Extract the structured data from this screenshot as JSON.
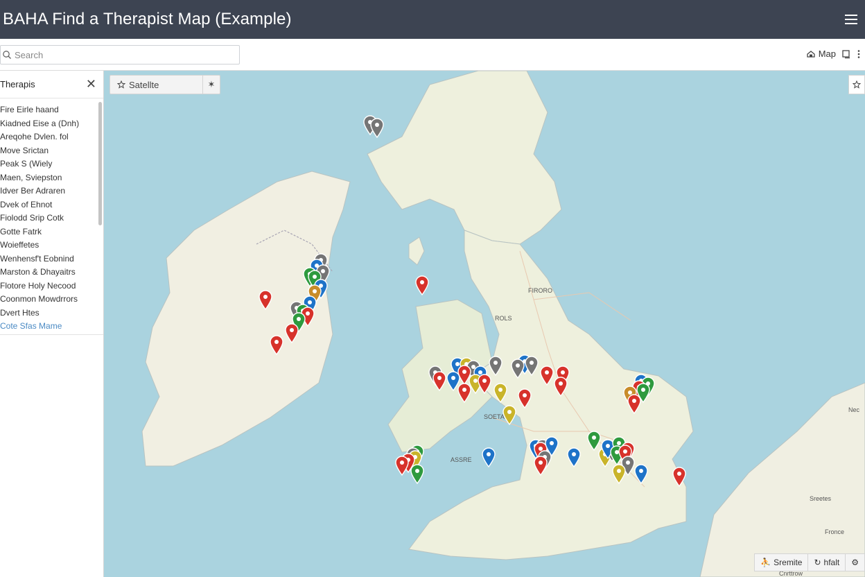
{
  "header": {
    "title": "BAHA Find a Therapist Map (Example)",
    "menu_icon": "hamburger-icon"
  },
  "toolbar": {
    "search_placeholder": "Search",
    "map_label": "Map",
    "icons": [
      "search-icon",
      "map-layers-icon",
      "window-icon",
      "more-vertical-icon"
    ]
  },
  "sidebar": {
    "title": "Therapis",
    "items": [
      "Fire Eirle haand",
      "Kiadned Eise a (Dnh)",
      "Areqohe Dvlen. fol",
      "Move Srictan",
      "Peak S (Wiely",
      "Maen, Sviepston",
      "Idver Ber Adraren",
      "Dvek of Ehnot",
      "Fiolodd Srip Cotk",
      "Gotte Fatrk",
      "Woieffetes",
      "Wenhensf't Eobnind",
      "Marston & Dhayaitrs",
      "Flotore Holy Necood",
      "Coonmon Mowdrrors",
      "Dvert Htes",
      "Cote Sfas Mame"
    ]
  },
  "map": {
    "type_label": "Satellte",
    "bottom_controls": [
      "Sremite",
      "hfalt"
    ],
    "place_labels": [
      "FIRORO",
      "ROLS",
      "SOETA",
      "ASSRE",
      "Nec",
      "Sreetes",
      "Fronce",
      "Cnrttrow"
    ],
    "markers": [
      {
        "lng": -5.45,
        "lat": 57.65,
        "color": "#757575"
      },
      {
        "lng": -5.3,
        "lat": 57.6,
        "color": "#757575"
      },
      {
        "lng": -6.55,
        "lat": 55.2,
        "color": "#757575"
      },
      {
        "lng": -6.65,
        "lat": 55.1,
        "color": "#1e73c8"
      },
      {
        "lng": -6.8,
        "lat": 54.95,
        "color": "#2e9a3e"
      },
      {
        "lng": -6.5,
        "lat": 55.0,
        "color": "#757575"
      },
      {
        "lng": -6.7,
        "lat": 54.9,
        "color": "#2e9a3e"
      },
      {
        "lng": -6.55,
        "lat": 54.75,
        "color": "#1e73c8"
      },
      {
        "lng": -6.7,
        "lat": 54.65,
        "color": "#c88c2a"
      },
      {
        "lng": -7.8,
        "lat": 54.55,
        "color": "#d7322b"
      },
      {
        "lng": -6.8,
        "lat": 54.45,
        "color": "#1e73c8"
      },
      {
        "lng": -7.1,
        "lat": 54.35,
        "color": "#757575"
      },
      {
        "lng": -6.95,
        "lat": 54.3,
        "color": "#2e9a3e"
      },
      {
        "lng": -6.85,
        "lat": 54.25,
        "color": "#d7322b"
      },
      {
        "lng": -7.05,
        "lat": 54.15,
        "color": "#2e9a3e"
      },
      {
        "lng": -7.2,
        "lat": 53.95,
        "color": "#d7322b"
      },
      {
        "lng": -7.55,
        "lat": 53.75,
        "color": "#d7322b"
      },
      {
        "lng": -4.3,
        "lat": 54.8,
        "color": "#d7322b"
      },
      {
        "lng": -3.5,
        "lat": 53.35,
        "color": "#1e73c8"
      },
      {
        "lng": -3.3,
        "lat": 53.35,
        "color": "#c9b42a"
      },
      {
        "lng": -3.15,
        "lat": 53.3,
        "color": "#757575"
      },
      {
        "lng": -3.35,
        "lat": 53.22,
        "color": "#d7322b"
      },
      {
        "lng": -3.0,
        "lat": 53.2,
        "color": "#1e73c8"
      },
      {
        "lng": -2.65,
        "lat": 53.38,
        "color": "#757575"
      },
      {
        "lng": -2.0,
        "lat": 53.4,
        "color": "#1e73c8"
      },
      {
        "lng": -1.85,
        "lat": 53.38,
        "color": "#757575"
      },
      {
        "lng": -2.15,
        "lat": 53.32,
        "color": "#757575"
      },
      {
        "lng": -4.0,
        "lat": 53.2,
        "color": "#757575"
      },
      {
        "lng": -3.9,
        "lat": 53.1,
        "color": "#d7322b"
      },
      {
        "lng": -3.6,
        "lat": 53.1,
        "color": "#1e73c8"
      },
      {
        "lng": -3.1,
        "lat": 53.05,
        "color": "#c9b42a"
      },
      {
        "lng": -2.9,
        "lat": 53.05,
        "color": "#d7322b"
      },
      {
        "lng": -1.5,
        "lat": 53.2,
        "color": "#d7322b"
      },
      {
        "lng": -1.15,
        "lat": 53.2,
        "color": "#d7322b"
      },
      {
        "lng": -1.2,
        "lat": 53.0,
        "color": "#d7322b"
      },
      {
        "lng": -3.35,
        "lat": 52.9,
        "color": "#d7322b"
      },
      {
        "lng": -2.55,
        "lat": 52.9,
        "color": "#c9b42a"
      },
      {
        "lng": -2.0,
        "lat": 52.8,
        "color": "#d7322b"
      },
      {
        "lng": -2.35,
        "lat": 52.5,
        "color": "#c9b42a"
      },
      {
        "lng": 0.6,
        "lat": 53.05,
        "color": "#1e73c8"
      },
      {
        "lng": 0.75,
        "lat": 53.0,
        "color": "#2e9a3e"
      },
      {
        "lng": 0.55,
        "lat": 52.95,
        "color": "#d7322b"
      },
      {
        "lng": 0.65,
        "lat": 52.9,
        "color": "#2e9a3e"
      },
      {
        "lng": 0.35,
        "lat": 52.85,
        "color": "#c88c2a"
      },
      {
        "lng": 0.45,
        "lat": 52.7,
        "color": "#d7322b"
      },
      {
        "lng": -4.4,
        "lat": 51.8,
        "color": "#2e9a3e"
      },
      {
        "lng": -4.5,
        "lat": 51.75,
        "color": "#757575"
      },
      {
        "lng": -4.45,
        "lat": 51.7,
        "color": "#c9b42a"
      },
      {
        "lng": -4.6,
        "lat": 51.65,
        "color": "#d7322b"
      },
      {
        "lng": -4.75,
        "lat": 51.6,
        "color": "#d7322b"
      },
      {
        "lng": -4.4,
        "lat": 51.45,
        "color": "#2e9a3e"
      },
      {
        "lng": -2.8,
        "lat": 51.75,
        "color": "#1e73c8"
      },
      {
        "lng": -1.75,
        "lat": 51.9,
        "color": "#1e73c8"
      },
      {
        "lng": -1.6,
        "lat": 51.9,
        "color": "#757575"
      },
      {
        "lng": -1.65,
        "lat": 51.85,
        "color": "#d7322b"
      },
      {
        "lng": -1.4,
        "lat": 51.95,
        "color": "#1e73c8"
      },
      {
        "lng": -1.55,
        "lat": 51.7,
        "color": "#757575"
      },
      {
        "lng": -1.65,
        "lat": 51.6,
        "color": "#d7322b"
      },
      {
        "lng": -0.9,
        "lat": 51.75,
        "color": "#1e73c8"
      },
      {
        "lng": -0.45,
        "lat": 52.05,
        "color": "#2e9a3e"
      },
      {
        "lng": -0.2,
        "lat": 51.75,
        "color": "#c9b42a"
      },
      {
        "lng": -0.05,
        "lat": 51.85,
        "color": "#757575"
      },
      {
        "lng": -0.15,
        "lat": 51.9,
        "color": "#1e73c8"
      },
      {
        "lng": 0.1,
        "lat": 51.95,
        "color": "#2e9a3e"
      },
      {
        "lng": 0.05,
        "lat": 51.78,
        "color": "#2e9a3e"
      },
      {
        "lng": 0.3,
        "lat": 51.85,
        "color": "#d7322b"
      },
      {
        "lng": 0.25,
        "lat": 51.8,
        "color": "#d7322b"
      },
      {
        "lng": 0.3,
        "lat": 51.6,
        "color": "#757575"
      },
      {
        "lng": 0.1,
        "lat": 51.45,
        "color": "#c9b42a"
      },
      {
        "lng": 0.6,
        "lat": 51.45,
        "color": "#1e73c8"
      },
      {
        "lng": 1.45,
        "lat": 51.4,
        "color": "#d7322b"
      }
    ]
  }
}
